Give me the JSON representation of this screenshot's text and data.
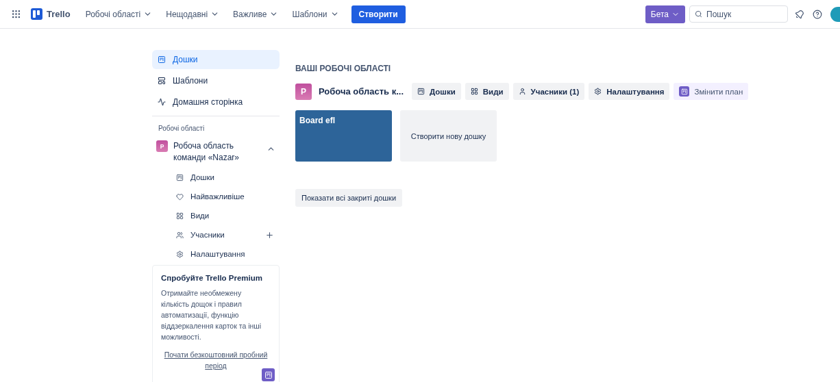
{
  "header": {
    "brand": "Trello",
    "nav": [
      {
        "label": "Робочі області"
      },
      {
        "label": "Нещодавні"
      },
      {
        "label": "Важливе"
      },
      {
        "label": "Шаблони"
      }
    ],
    "create": "Створити",
    "beta": "Бета",
    "search": {
      "placeholder": "Пошук"
    }
  },
  "sidebar": {
    "items": [
      {
        "label": "Дошки",
        "selected": true
      },
      {
        "label": "Шаблони",
        "selected": false
      },
      {
        "label": "Домашня сторінка",
        "selected": false
      }
    ],
    "section_title": "Робочі області",
    "workspace": {
      "initial": "P",
      "name": "Робоча область команди «Nazar»",
      "expanded": true,
      "children": [
        {
          "label": "Дошки",
          "addable": false
        },
        {
          "label": "Найважливіше",
          "addable": false
        },
        {
          "label": "Види",
          "addable": false
        },
        {
          "label": "Учасники",
          "addable": true
        },
        {
          "label": "Налаштування",
          "addable": false
        }
      ]
    },
    "premium": {
      "title": "Спробуйте Trello Premium",
      "text": "Отримайте необмежену кількість дощок і правил автоматизації, функцію віддзеркалення карток та інші можливості.",
      "link": "Почати безкоштовний пробний період"
    }
  },
  "main": {
    "heading": "ВАШІ РОБОЧІ ОБЛАСТІ",
    "workspace": {
      "initial": "P",
      "name": "Робоча область к...",
      "tabs": [
        {
          "label": "Дошки",
          "kind": "plain"
        },
        {
          "label": "Види",
          "kind": "plain"
        },
        {
          "label": "Учасники (1)",
          "kind": "plain"
        },
        {
          "label": "Налаштування",
          "kind": "plain"
        },
        {
          "label": "Змінити план",
          "kind": "upgrade"
        }
      ]
    },
    "boards": [
      {
        "title": "Board efl",
        "color": "#2d6499"
      }
    ],
    "create_board": "Створити нову дошку",
    "closed_boards": "Показати всі закриті дошки"
  }
}
